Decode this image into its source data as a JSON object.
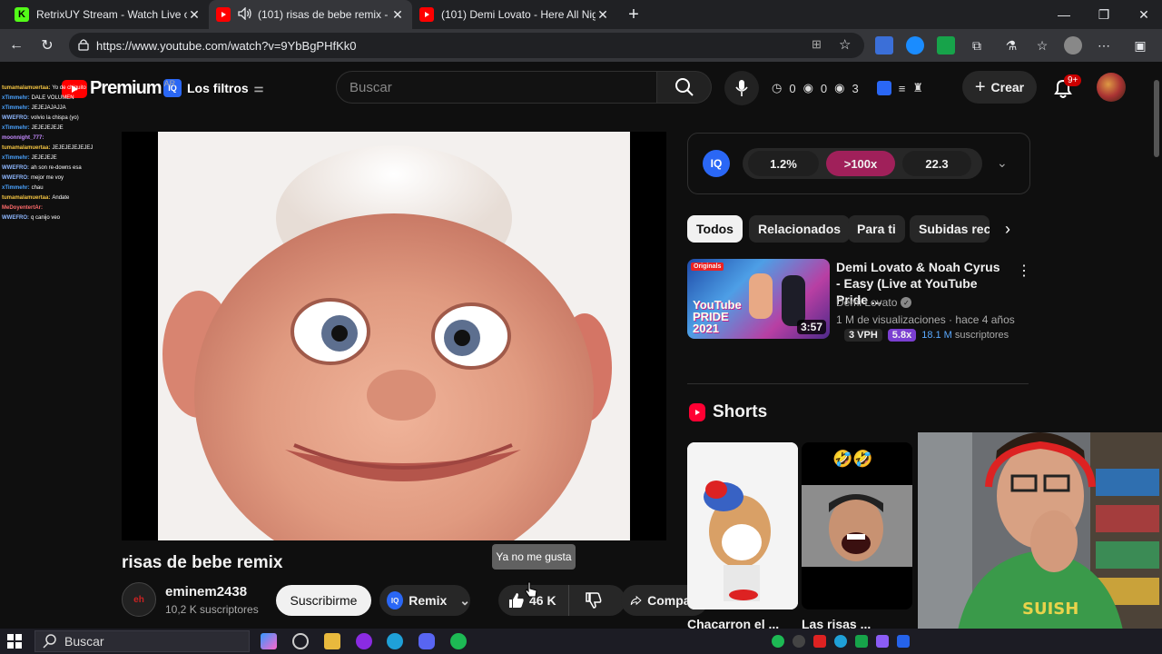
{
  "browser": {
    "tabs": [
      {
        "title": "RetrixUY Stream - Watch Live on Kick",
        "favicon_color": "#53fc18"
      },
      {
        "title": "(101) risas de bebe remix - YouTube",
        "favicon_color": "#ff0000"
      },
      {
        "title": "(101) Demi Lovato - Here All Night",
        "favicon_color": "#ff0000"
      }
    ],
    "new_tab": "+",
    "url": "https://www.youtube.com/watch?v=9YbBgPHfKk0"
  },
  "youtube": {
    "logo_text": "Premium",
    "country": "AR",
    "filters_label": "Los filtros",
    "search_placeholder": "Buscar",
    "stats": [
      "0",
      "0",
      "3"
    ],
    "create_label": "Crear",
    "notif_count": "9+"
  },
  "chat": [
    {
      "user": "tumamalamuertaa:",
      "msg": "Yo de chiquito",
      "color": "#f5c542"
    },
    {
      "user": "xTimmehr:",
      "msg": "DALE VOLUMEN",
      "color": "#4aa3ff"
    },
    {
      "user": "xTimmehr:",
      "msg": "JEJEJAJAJJA",
      "color": "#4aa3ff"
    },
    {
      "user": "WWEFRO:",
      "msg": "volvio la chispa (yo)",
      "color": "#8fb8ff"
    },
    {
      "user": "xTimmehr:",
      "msg": "JEJEJEJEJE",
      "color": "#4aa3ff"
    },
    {
      "user": "moonnight_777:",
      "msg": "",
      "color": "#c58bff"
    },
    {
      "user": "tumamalamuertaa:",
      "msg": "JEJEJEJEJEJEJ",
      "color": "#f5c542"
    },
    {
      "user": "xTimmehr:",
      "msg": "JEJEJEJE",
      "color": "#4aa3ff"
    },
    {
      "user": "WWEFRO:",
      "msg": "ah son re-downs esa",
      "color": "#8fb8ff"
    },
    {
      "user": "WWEFRO:",
      "msg": "mejor me voy",
      "color": "#8fb8ff"
    },
    {
      "user": "xTimmehr:",
      "msg": "chau",
      "color": "#4aa3ff"
    },
    {
      "user": "tumamalamuertaa:",
      "msg": "Andate",
      "color": "#f5c542"
    },
    {
      "user": "MeDoyentertAr:",
      "msg": "",
      "color": "#ff6b6b"
    },
    {
      "user": "WWEFRO:",
      "msg": "q canijo veo",
      "color": "#8fb8ff"
    }
  ],
  "video": {
    "title": "risas de bebe remix",
    "channel": "eminem2438",
    "subscribers": "10,2 K suscriptores",
    "subscribe_label": "Suscribirme",
    "remix_label": "Remix",
    "likes": "46 K",
    "share_label": "Compartir",
    "tooltip": "Ya no me gusta"
  },
  "iq": {
    "logo": "IQ",
    "pills": [
      "1.2%",
      ">100x",
      "22.3"
    ]
  },
  "chips": [
    "Todos",
    "Relacionados",
    "Para ti",
    "Subidas recientes"
  ],
  "recommended": {
    "title": "Demi Lovato & Noah Cyrus - Easy (Live at YouTube Pride ...",
    "channel": "Demi Lovato",
    "meta": "1 M de visualizaciones · hace 4 años",
    "duration": "3:57",
    "thumb_tag": "Originals",
    "thumb_caption": "YouTube PRIDE 2021",
    "vph": "3 VPH",
    "ratio": "5.8x",
    "subs_count": "18.1 M",
    "subs_word": "suscriptores"
  },
  "shorts": {
    "heading": "Shorts",
    "items": [
      {
        "title": "Chacarron el ..."
      },
      {
        "title": "Las risas ...",
        "emoji": "🤣🤣"
      }
    ]
  },
  "taskbar": {
    "search_label": "Buscar"
  }
}
